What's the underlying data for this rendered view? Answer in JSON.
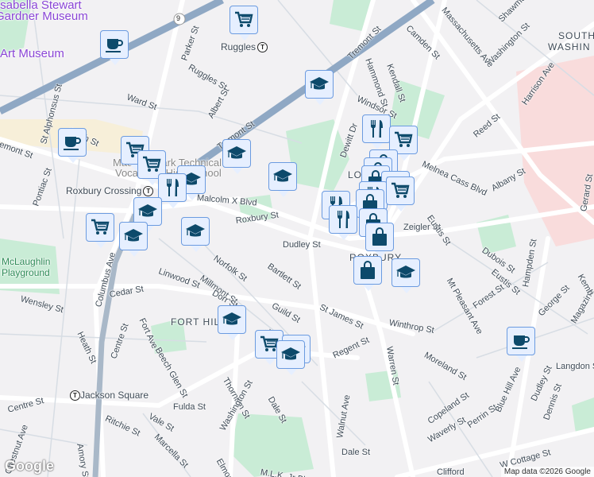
{
  "pois": {
    "gardner": "Isabella Stewart",
    "gardner2": "Gardner Museum",
    "art": "Art Museum",
    "school1": "Madison Park Technical",
    "school2": "Vocational High School",
    "playground1": "McLaughlin",
    "playground2": "Playground"
  },
  "stations": {
    "ruggles": "Ruggles",
    "roxbury_crossing": "Roxbury Crossing",
    "jackson": "Jackson Square",
    "t": "T"
  },
  "route": "9",
  "areas": {
    "fort_hill": "FORT HILL",
    "roxbury": "ROXBURY",
    "lower": "LOWER",
    "south1": "SOUTH",
    "south2": "WASHIN"
  },
  "streets": [
    "Parker St",
    "Ruggles St",
    "Ward St",
    "Albert St",
    "Tremont St",
    "St Alphonsus St",
    "Smith St",
    "Tremont St",
    "Pontiac St",
    "Malcolm X Blvd",
    "Roxbury St",
    "Dudley St",
    "Norfolk St",
    "Bartlett St",
    "Millmont St",
    "Linwood St",
    "Cedar St",
    "Wensley St",
    "Dorr St",
    "Guild St",
    "St James St",
    "Fort Ave",
    "Centre St",
    "Beech Glen St",
    "Heath St",
    "Columbus Ave",
    "Regent St",
    "Thornton St",
    "Dale St",
    "Washington St",
    "Fulda St",
    "Centre St",
    "Ritchie St",
    "Vale St",
    "Marcella St",
    "Amory St",
    "Chestnut Ave",
    "Elmore St",
    "M.L.K. Jr Blvd",
    "Walnut Ave",
    "Warren St",
    "Moreland St",
    "Winthrop St",
    "Copeland St",
    "Perrin St",
    "Waverly St",
    "Dale St",
    "Clifford",
    "W Cottage St",
    "Blue Hill Ave",
    "Dudley St",
    "Dennis St",
    "Langdon St",
    "Forest St",
    "George St",
    "Eustis St",
    "Dubois St",
    "Mt Pleasant Ave",
    "Zeigler St",
    "Eustis St",
    "Hampden St",
    "Magazine",
    "Kemb",
    "Gerard St",
    "Albany St",
    "Melnea Cass Blvd",
    "Reed St",
    "Harrison Ave",
    "Washington St",
    "Massachusetts Ave",
    "Shawmut",
    "Camden St",
    "Kendall St",
    "Hammond St",
    "Tremont St",
    "Windsor St",
    "Dewitt Dr",
    "Jul"
  ],
  "markers": [
    {
      "type": "shopping"
    },
    {
      "type": "cafe"
    },
    {
      "type": "school"
    },
    {
      "type": "cafe"
    },
    {
      "type": "restaurant"
    },
    {
      "type": "shopping"
    },
    {
      "type": "shopping"
    },
    {
      "type": "shopping"
    },
    {
      "type": "school"
    },
    {
      "type": "school"
    },
    {
      "type": "school"
    },
    {
      "type": "restaurant"
    },
    {
      "type": "store"
    },
    {
      "type": "store"
    },
    {
      "type": "store"
    },
    {
      "type": "shopping"
    },
    {
      "type": "restaurant"
    },
    {
      "type": "store"
    },
    {
      "type": "restaurant"
    },
    {
      "type": "shopping"
    },
    {
      "type": "restaurant"
    },
    {
      "type": "store"
    },
    {
      "type": "store"
    },
    {
      "type": "school"
    },
    {
      "type": "shopping"
    },
    {
      "type": "school"
    },
    {
      "type": "school"
    },
    {
      "type": "store"
    },
    {
      "type": "school"
    },
    {
      "type": "school"
    },
    {
      "type": "shopping"
    },
    {
      "type": "school"
    },
    {
      "type": "school"
    },
    {
      "type": "cafe"
    }
  ],
  "colors": {
    "marker_fill": "#e6efff",
    "marker_border": "#6b9be0",
    "icon": "#0d4a6b",
    "poi": "#8a45d6",
    "park": "#c9ecd6",
    "transit": "#8fa8c4"
  },
  "attribution": "Map data ©2026 Google",
  "logo": "Google"
}
